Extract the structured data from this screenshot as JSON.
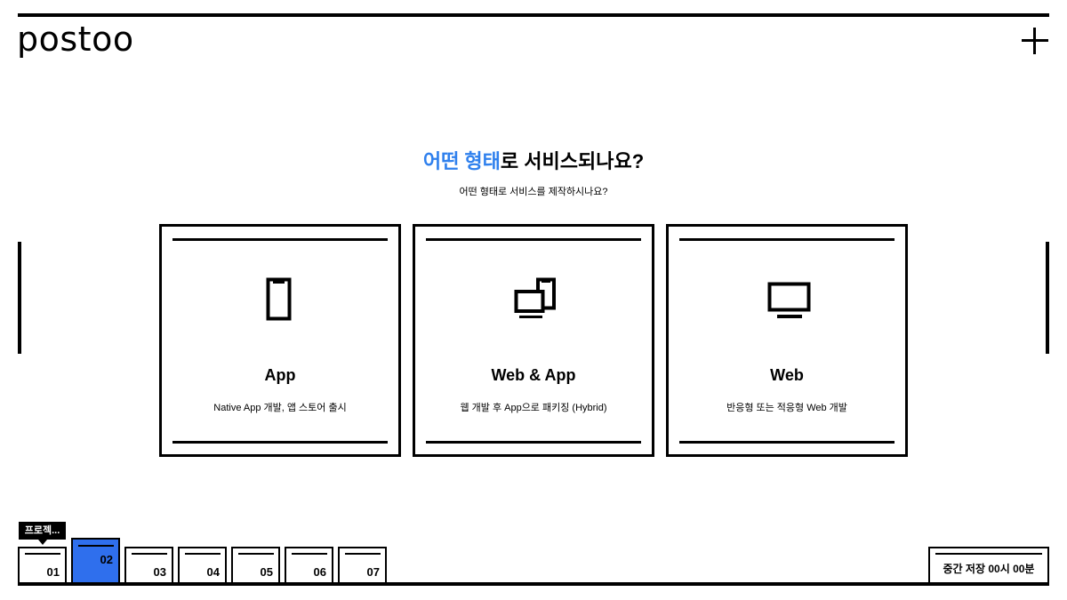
{
  "header": {
    "logo": "postoo",
    "add_icon": "plus-icon"
  },
  "question": {
    "title_accent": "어떤 형태",
    "title_rest": "로 서비스되나요?",
    "subtitle": "어떤 형태로 서비스를 제작하시나요?"
  },
  "options": [
    {
      "title": "App",
      "description": "Native App 개발, 앱 스토어 출시",
      "icon": "mobile-phone-icon"
    },
    {
      "title": "Web & App",
      "description": "웹 개발 후 App으로 패키징 (Hybrid)",
      "icon": "desktop-and-phone-icon"
    },
    {
      "title": "Web",
      "description": "반응형 또는 적응형 Web 개발",
      "icon": "monitor-icon"
    }
  ],
  "tooltip": "프로젝...",
  "steps": [
    "01",
    "02",
    "03",
    "04",
    "05",
    "06",
    "07"
  ],
  "active_step": "02",
  "save_status": "중간 저장 00시 00분",
  "colors": {
    "accent": "#2f80ed",
    "active_step": "#2f6fed",
    "ink": "#000000"
  }
}
